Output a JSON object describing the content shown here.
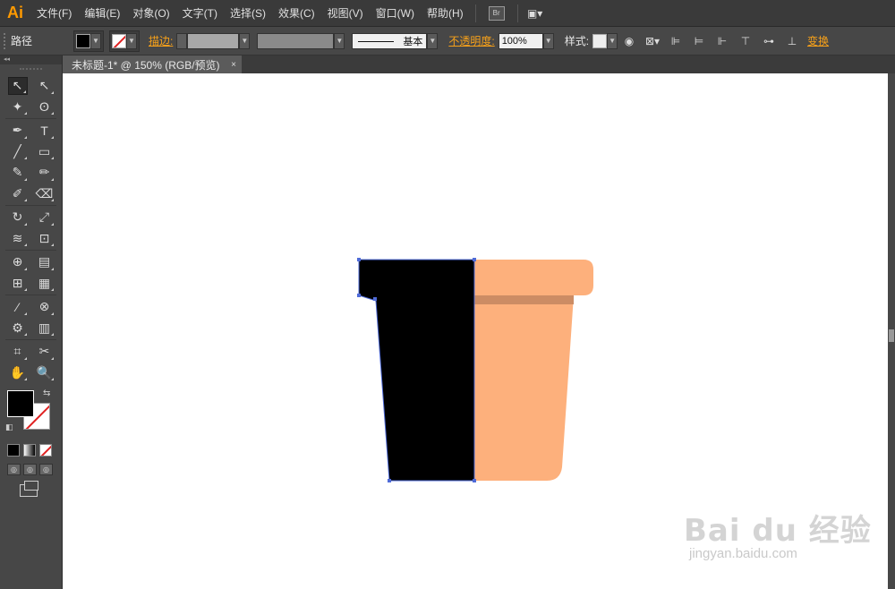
{
  "app": {
    "logo": "Ai"
  },
  "menu": [
    "文件(F)",
    "编辑(E)",
    "对象(O)",
    "文字(T)",
    "选择(S)",
    "效果(C)",
    "视图(V)",
    "窗口(W)",
    "帮助(H)"
  ],
  "menu_icons": {
    "bridge": "Br",
    "arrange": "arrange-documents-icon"
  },
  "control_bar": {
    "selection_label": "路径",
    "stroke_label": "描边:",
    "basic_label": "基本",
    "opacity_label": "不透明度:",
    "opacity_value": "100%",
    "style_label": "样式:",
    "transform_label": "变换",
    "fill_color": "#000000",
    "stroke_color": "none"
  },
  "document": {
    "tab_title": "未标题-1* @ 150% (RGB/预览)",
    "close": "×"
  },
  "tools": [
    [
      "selection-tool",
      "direct-selection-tool"
    ],
    [
      "magic-wand-tool",
      "lasso-tool"
    ],
    [
      "pen-tool",
      "type-tool"
    ],
    [
      "line-segment-tool",
      "rectangle-tool"
    ],
    [
      "paintbrush-tool",
      "pencil-tool"
    ],
    [
      "blob-brush-tool",
      "eraser-tool"
    ],
    [
      "rotate-tool",
      "scale-tool"
    ],
    [
      "width-tool",
      "free-transform-tool"
    ],
    [
      "shape-builder-tool",
      "perspective-grid-tool"
    ],
    [
      "mesh-tool",
      "gradient-tool"
    ],
    [
      "eyedropper-tool",
      "blend-tool"
    ],
    [
      "symbol-sprayer-tool",
      "column-graph-tool"
    ],
    [
      "artboard-tool",
      "slice-tool"
    ],
    [
      "hand-tool",
      "zoom-tool"
    ]
  ],
  "tool_glyphs": [
    [
      "↖",
      "↖"
    ],
    [
      "✦",
      "ʘ"
    ],
    [
      "✒",
      "T"
    ],
    [
      "╱",
      "▭"
    ],
    [
      "✎",
      "✏"
    ],
    [
      "✐",
      "⌫"
    ],
    [
      "↻",
      "⤢"
    ],
    [
      "≋",
      "⊡"
    ],
    [
      "⊕",
      "▤"
    ],
    [
      "⊞",
      "▦"
    ],
    [
      "⁄",
      "⊗"
    ],
    [
      "⚙",
      "▥"
    ],
    [
      "⌗",
      "✂"
    ],
    [
      "✋",
      "🔍"
    ]
  ],
  "colors": {
    "fill": "#000000",
    "pot_orange": "#FDB07C",
    "pot_band": "#CC8C64",
    "selection": "#4F6BD8"
  },
  "watermark": {
    "main": "Bai du 经验",
    "sub": "jingyan.baidu.com"
  }
}
